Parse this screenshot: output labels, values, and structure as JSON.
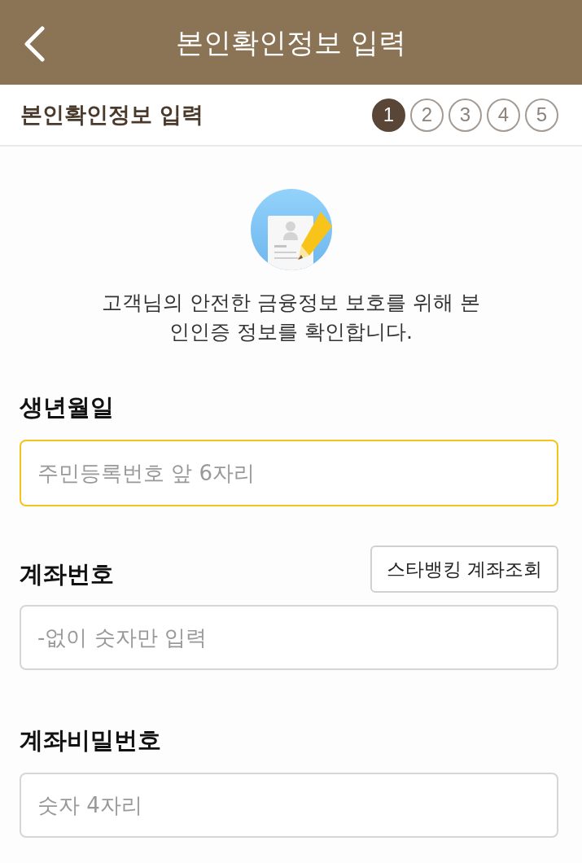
{
  "header": {
    "title": "본인확인정보 입력"
  },
  "progress": {
    "title": "본인확인정보 입력",
    "steps": [
      {
        "label": "1",
        "selected": true
      },
      {
        "label": "2",
        "selected": false
      },
      {
        "label": "3",
        "selected": false
      },
      {
        "label": "4",
        "selected": false
      },
      {
        "label": "5",
        "selected": false
      }
    ]
  },
  "intro": {
    "text": "고객님의 안전한 금융정보 보호를 위해 본인인증 정보를 확인합니다."
  },
  "fields": [
    {
      "label": "생년월일",
      "placeholder": "주민등록번호 앞 6자리",
      "focused": true
    },
    {
      "label": "계좌번호",
      "placeholder": "-없이 숫자만 입력",
      "focused": false,
      "action": "스타뱅킹 계좌조회"
    },
    {
      "label": "계좌비밀번호",
      "placeholder": "숫자 4자리",
      "focused": false
    }
  ]
}
